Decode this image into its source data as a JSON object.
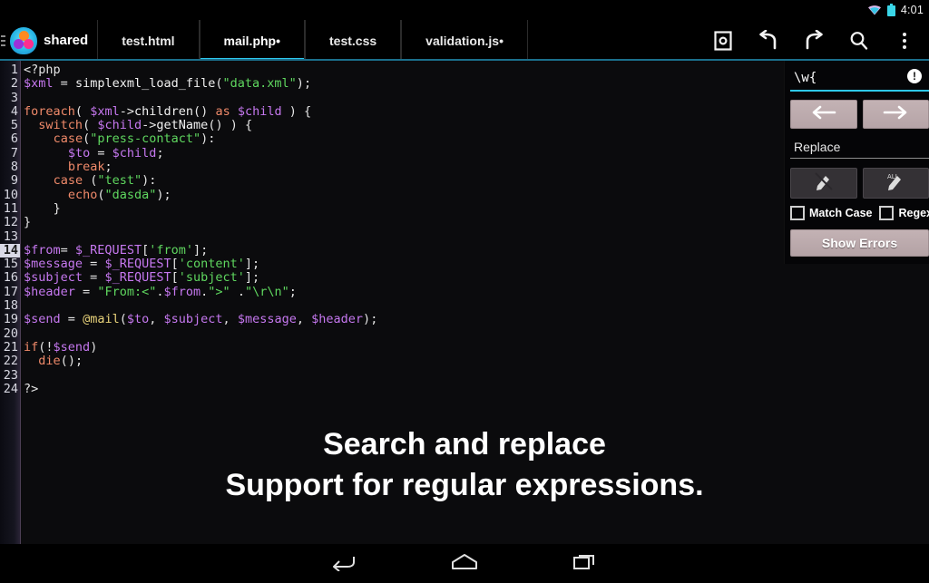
{
  "status_bar": {
    "time": "4:01",
    "icons": [
      "wifi-icon",
      "battery-icon"
    ]
  },
  "toolbar": {
    "app_name": "shared",
    "logo_icon": "app-logo-icon",
    "drawer_icon": "drawer-grip-icon",
    "tabs": [
      {
        "label": "test.html",
        "active": false,
        "modified": false
      },
      {
        "label": "mail.php•",
        "active": true,
        "modified": true
      },
      {
        "label": "test.css",
        "active": false,
        "modified": false
      },
      {
        "label": "validation.js•",
        "active": false,
        "modified": true
      }
    ],
    "actions": [
      {
        "name": "save-button",
        "icon": "save-icon"
      },
      {
        "name": "undo-button",
        "icon": "undo-icon"
      },
      {
        "name": "redo-button",
        "icon": "redo-icon"
      },
      {
        "name": "search-button",
        "icon": "search-icon"
      },
      {
        "name": "overflow-menu-button",
        "icon": "more-vertical-icon"
      }
    ],
    "accent_color": "#2ec8ee"
  },
  "editor": {
    "current_line": 14,
    "total_lines": 24,
    "line_numbers": [
      "1",
      "2",
      "3",
      "4",
      "5",
      "6",
      "7",
      "8",
      "9",
      "10",
      "11",
      "12",
      "13",
      "14",
      "15",
      "16",
      "17",
      "18",
      "19",
      "20",
      "21",
      "22",
      "23",
      "24"
    ],
    "lines": [
      "<?php",
      "$xml = simplexml_load_file(\"data.xml\");",
      "",
      "foreach( $xml->children() as $child ) {",
      "  switch( $child->getName() ) {",
      "    case(\"press-contact\"):",
      "      $to = $child;",
      "      break;",
      "    case (\"test\"):",
      "      echo(\"dasda\");",
      "    }",
      "}",
      "",
      "$from= $_REQUEST['from'];",
      "$message = $_REQUEST['content'];",
      "$subject = $_REQUEST['subject'];",
      "$header = \"From:<\".$from.\">\" .\"\\r\\n\";",
      "",
      "$send = @mail($to, $subject, $message, $header);",
      "",
      "if(!$send)",
      "  die();",
      "",
      "?>"
    ],
    "language": "php",
    "filename": "mail.php",
    "colors": {
      "background": "#0b0b0d",
      "keyword": "#f08a6a",
      "variable": "#c678f0",
      "string": "#5fd75f",
      "function": "#f2f2f2",
      "at_operator": "#e8d27a",
      "gutter_text": "#d8d8e2",
      "current_line_highlight": "#d9d9e6"
    }
  },
  "search_panel": {
    "search_value": "\\w{",
    "search_error_icon": "error-exclamation-icon",
    "replace_placeholder": "Replace",
    "replace_value": "",
    "prev_icon": "arrow-left-icon",
    "next_icon": "arrow-right-icon",
    "replace_icon": "replace-one-icon",
    "replace_all_icon": "replace-all-icon",
    "match_case_label": "Match Case",
    "match_case_checked": false,
    "regex_label": "Regex",
    "regex_checked": false,
    "show_errors_label": "Show Errors"
  },
  "caption": {
    "line1": "Search and replace",
    "line2": "Support for regular expressions."
  },
  "nav_bar": {
    "buttons": [
      {
        "name": "android-back-button",
        "icon": "back-arrow-icon"
      },
      {
        "name": "android-home-button",
        "icon": "home-icon"
      },
      {
        "name": "android-recents-button",
        "icon": "recents-icon"
      }
    ]
  }
}
